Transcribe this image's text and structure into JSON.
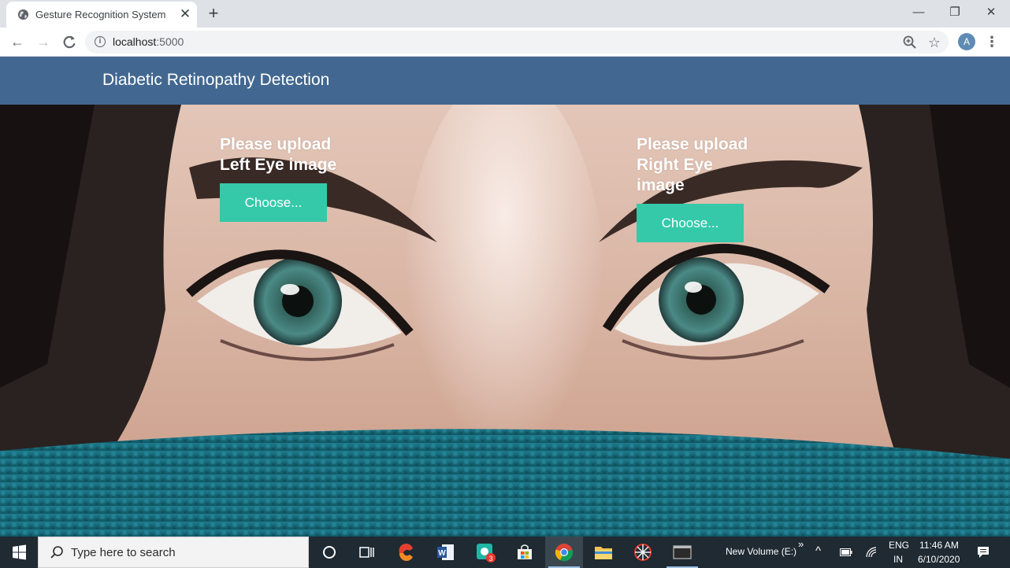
{
  "browser": {
    "tab_title": "Gesture Recognition System",
    "tab_close": "✕",
    "new_tab": "+",
    "url_host": "localhost",
    "url_port": ":5000",
    "avatar_letter": "A",
    "window_minimize": "—",
    "window_restore": "❐",
    "window_close": "✕"
  },
  "app": {
    "brand": "Diabetic Retinopathy Detection",
    "left_upload": {
      "title": "Please upload Left Eye image",
      "button": "Choose..."
    },
    "right_upload": {
      "title": "Please upload Right Eye image",
      "button": "Choose..."
    }
  },
  "taskbar": {
    "search_placeholder": "Type here to search",
    "notification_badge": "3",
    "drive_label": "New Volume (E:)",
    "overflow": "»",
    "lang_top": "ENG",
    "lang_bottom": "IN",
    "time": "11:46 AM",
    "date": "6/10/2020"
  },
  "colors": {
    "navbar": "#426891",
    "button": "#35c9aa",
    "taskbar": "#1f2a33"
  }
}
